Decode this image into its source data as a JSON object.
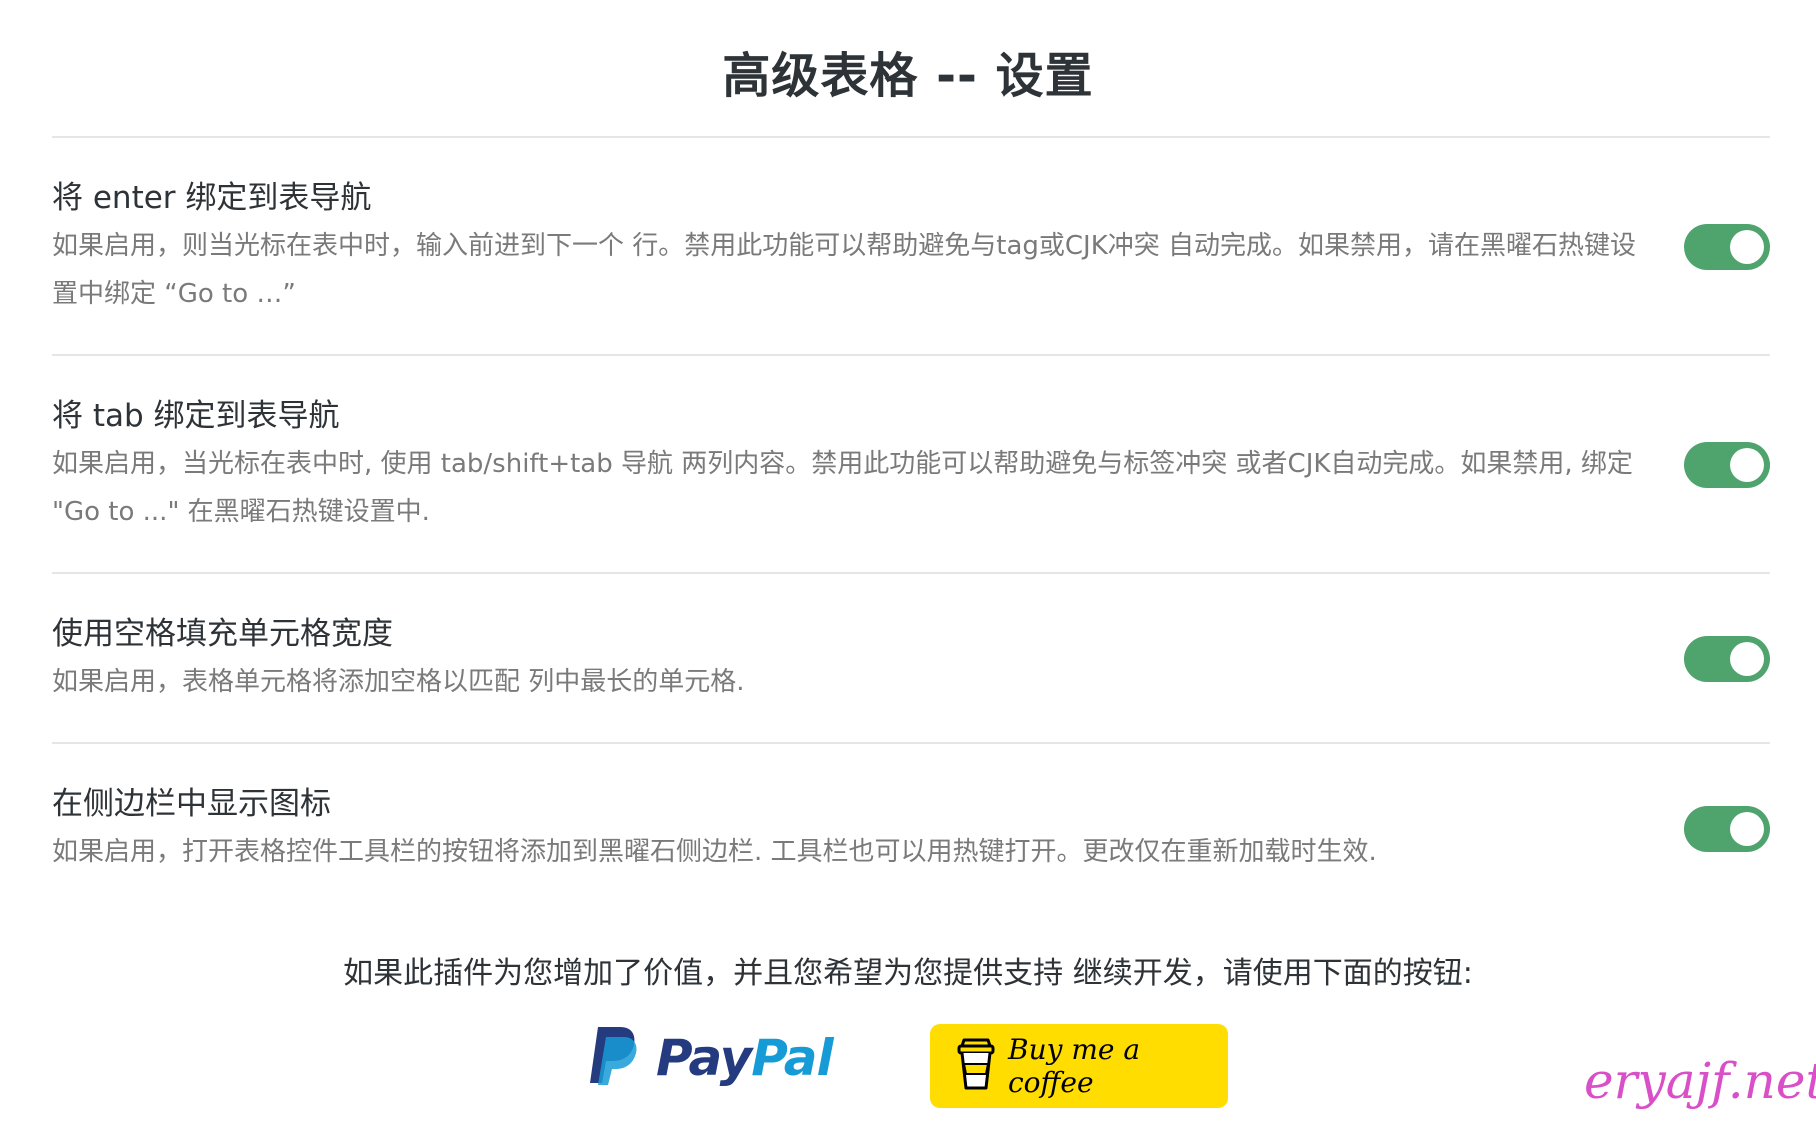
{
  "page": {
    "title": "高级表格 -- 设置"
  },
  "settings": [
    {
      "name": "将 enter 绑定到表导航",
      "description": "如果启用，则当光标在表中时，输入前进到下一个 行。禁用此功能可以帮助避免与tag或CJK冲突 自动完成。如果禁用，请在黑曜石热键设置中绑定 “Go to …”",
      "enabled": true
    },
    {
      "name": "将 tab 绑定到表导航",
      "description": "如果启用，当光标在表中时, 使用 tab/shift+tab 导航 两列内容。禁用此功能可以帮助避免与标签冲突 或者CJK自动完成。如果禁用, 绑定 \"Go to ...\" 在黑曜石热键设置中.",
      "enabled": true
    },
    {
      "name": "使用空格填充单元格宽度",
      "description": "如果启用，表格单元格将添加空格以匹配 列中最长的单元格.",
      "enabled": true
    },
    {
      "name": "在侧边栏中显示图标",
      "description": "如果启用，打开表格控件工具栏的按钮将添加到黑曜石侧边栏. 工具栏也可以用热键打开。更改仅在重新加载时生效.",
      "enabled": true
    }
  ],
  "support": {
    "text": "如果此插件为您增加了价值，并且您希望为您提供支持 继续开发，请使用下面的按钮:",
    "paypal_pay": "Pay",
    "paypal_pal": "Pal",
    "bmc_label": "Buy me a coffee"
  },
  "watermark": "eryajf.net",
  "colors": {
    "toggle_on": "#4fa36d",
    "paypal_dark": "#253b80",
    "paypal_light": "#179bd7",
    "bmc_yellow": "#ffdd00",
    "watermark": "#d94fc8"
  },
  "icons": {
    "paypal": "paypal-logo-icon",
    "coffee": "coffee-cup-icon"
  }
}
